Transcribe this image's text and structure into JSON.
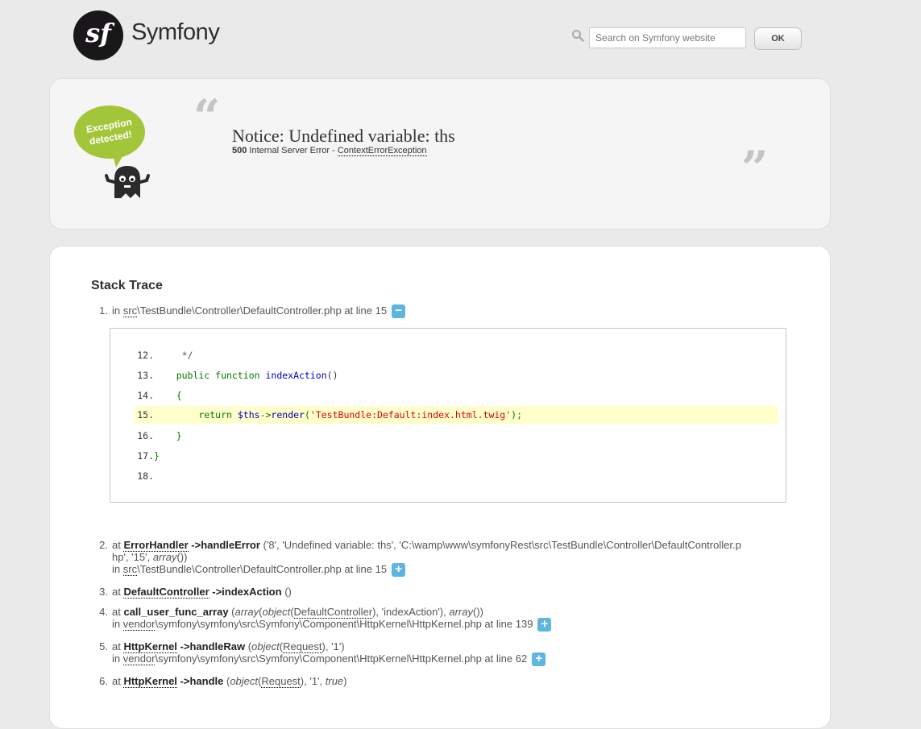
{
  "header": {
    "brand": "Symfony",
    "logo_glyph": "sf",
    "search_placeholder": "Search on Symfony website",
    "ok_label": "OK"
  },
  "exception": {
    "badge_line1": "Exception",
    "badge_line2": "detected!",
    "title": "Notice: Undefined variable: ths",
    "status_code": "500",
    "status_text": "Internal Server Error -",
    "class": "ContextErrorException"
  },
  "stack": {
    "title": "Stack Trace",
    "t1": {
      "num": "1.",
      "prefix": "in ",
      "abbr": "src",
      "path": "\\TestBundle\\Controller\\DefaultController.php at line 15",
      "toggle": "−"
    },
    "code": [
      {
        "ln": "12.",
        "text": "     */"
      },
      {
        "ln": "13.",
        "text": "    public function indexAction()"
      },
      {
        "ln": "14.",
        "text": "    {"
      },
      {
        "ln": "15.",
        "text": "        return $ths->render('TestBundle:Default:index.html.twig');"
      },
      {
        "ln": "16.",
        "text": "    }"
      },
      {
        "ln": "17.",
        "text": "}"
      },
      {
        "ln": "18.",
        "text": ""
      }
    ],
    "t2": {
      "num": "2.",
      "at": "at ",
      "cls": "ErrorHandler",
      "meth": " ->handleError",
      "args_line1": " ('8', 'Undefined variable: ths', 'C:\\wamp\\www\\symfonyRest\\src\\TestBundle\\Controller\\DefaultController.p",
      "args_line2a": "hp', '15', ",
      "args_line2b": "array",
      "args_line2c": "())",
      "in": "in ",
      "abbr": "src",
      "path": "\\TestBundle\\Controller\\DefaultController.php at line 15",
      "toggle": "+"
    },
    "t3": {
      "num": "3.",
      "at": "at ",
      "cls": "DefaultController",
      "meth": " ->indexAction",
      "args": " ()"
    },
    "t4": {
      "num": "4.",
      "at": "at ",
      "meth": "call_user_func_array",
      "args_a": " (",
      "args_b": "array",
      "args_c": "(",
      "args_d": "object",
      "args_e": "(",
      "args_f": "DefaultController",
      "args_g": "), 'indexAction'), ",
      "args_h": "array",
      "args_i": "())",
      "in": "in ",
      "abbr": "vendor",
      "path": "\\symfony\\symfony\\src\\Symfony\\Component\\HttpKernel\\HttpKernel.php at line 139",
      "toggle": "+"
    },
    "t5": {
      "num": "5.",
      "at": "at ",
      "cls": "HttpKernel",
      "meth": " ->handleRaw",
      "args_a": " (",
      "args_b": "object",
      "args_c": "(",
      "args_d": "Request",
      "args_e": "), '1')",
      "in": "in ",
      "abbr": "vendor",
      "path": "\\symfony\\symfony\\src\\Symfony\\Component\\HttpKernel\\HttpKernel.php at line 62",
      "toggle": "+"
    },
    "t6": {
      "num": "6.",
      "at": "at ",
      "cls": "HttpKernel",
      "meth": " ->handle",
      "args_a": " (",
      "args_b": "object",
      "args_c": "(",
      "args_d": "Request",
      "args_e": "), '1', ",
      "args_f": "true",
      "args_g": ")"
    }
  }
}
